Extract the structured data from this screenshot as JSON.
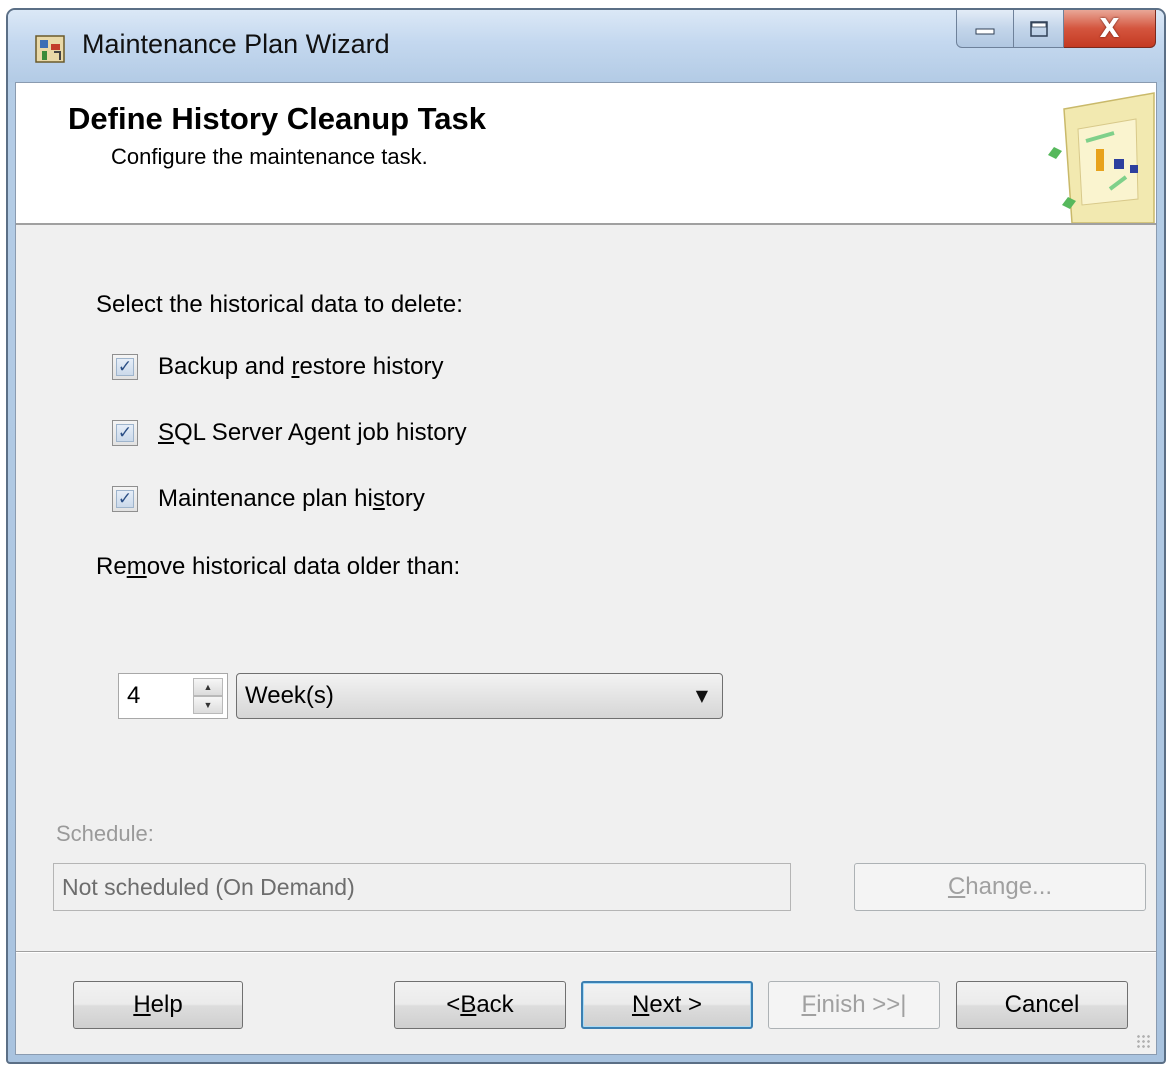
{
  "window": {
    "title": "Maintenance Plan Wizard",
    "controls": {
      "minimize": "minimize",
      "maximize": "maximize",
      "close": "X"
    }
  },
  "header": {
    "title": "Define History Cleanup Task",
    "subtitle": "Configure the maintenance task."
  },
  "historical_data": {
    "label": "Select the historical data to delete:",
    "options": [
      {
        "label_pre": "Backup and ",
        "accel": "r",
        "label_post": "estore history",
        "checked": true
      },
      {
        "label_pre": "",
        "accel": "S",
        "label_post": "QL Server Agent job history",
        "checked": true
      },
      {
        "label_pre": "Maintenance plan hi",
        "accel": "s",
        "label_post": "tory",
        "checked": true
      }
    ]
  },
  "retention": {
    "label_pre": "Re",
    "label_accel": "m",
    "label_post": "ove historical data older than:",
    "value": "4",
    "unit": "Week(s)"
  },
  "schedule": {
    "label": "Schedule:",
    "value": "Not scheduled (On Demand)",
    "change_accel": "C",
    "change_rest": "hange..."
  },
  "buttons": {
    "help_accel": "H",
    "help_rest": "elp",
    "back_pre": "< ",
    "back_accel": "B",
    "back_rest": "ack",
    "next_accel": "N",
    "next_rest": "ext >",
    "finish_accel": "F",
    "finish_rest": "inish >>|",
    "cancel": "Cancel"
  },
  "icons": {
    "title_icon": "wizard-app-icon",
    "header_graphic": "maintenance-plan-graphic-icon",
    "checkmark": "✓",
    "dropdown_arrow": "▼",
    "spin_up": "▲",
    "spin_down": "▼"
  },
  "colors": {
    "title_bar": "#c4d8ef",
    "close_button": "#d4553e",
    "default_button_border": "#3c7fb1",
    "disabled_text": "#a0a0a0"
  }
}
